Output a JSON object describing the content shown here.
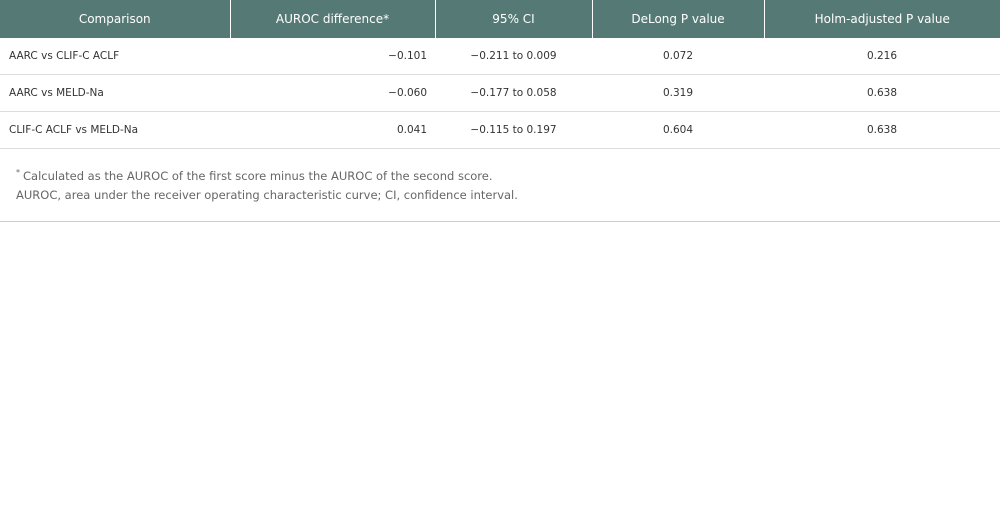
{
  "table": {
    "headers": [
      "Comparison",
      "AUROC difference*",
      "95% CI",
      "DeLong P value",
      "Holm-adjusted P value"
    ],
    "rows": [
      [
        "AARC vs CLIF-C ACLF",
        "−0.101",
        "−0.211 to 0.009",
        "0.072",
        "0.216"
      ],
      [
        "AARC vs MELD-Na",
        "−0.060",
        "−0.177 to 0.058",
        "0.319",
        "0.638"
      ],
      [
        "CLIF-C ACLF vs MELD-Na",
        "0.041",
        "−0.115 to 0.197",
        "0.604",
        "0.638"
      ]
    ]
  },
  "footnotes": {
    "marker": "*",
    "line1": "Calculated as the AUROC of the first score minus the AUROC of the second score.",
    "line2": "AUROC, area under the receiver operating characteristic curve; CI, confidence interval."
  },
  "colors": {
    "header_bg": "#557a76",
    "header_text": "#ffffff"
  }
}
